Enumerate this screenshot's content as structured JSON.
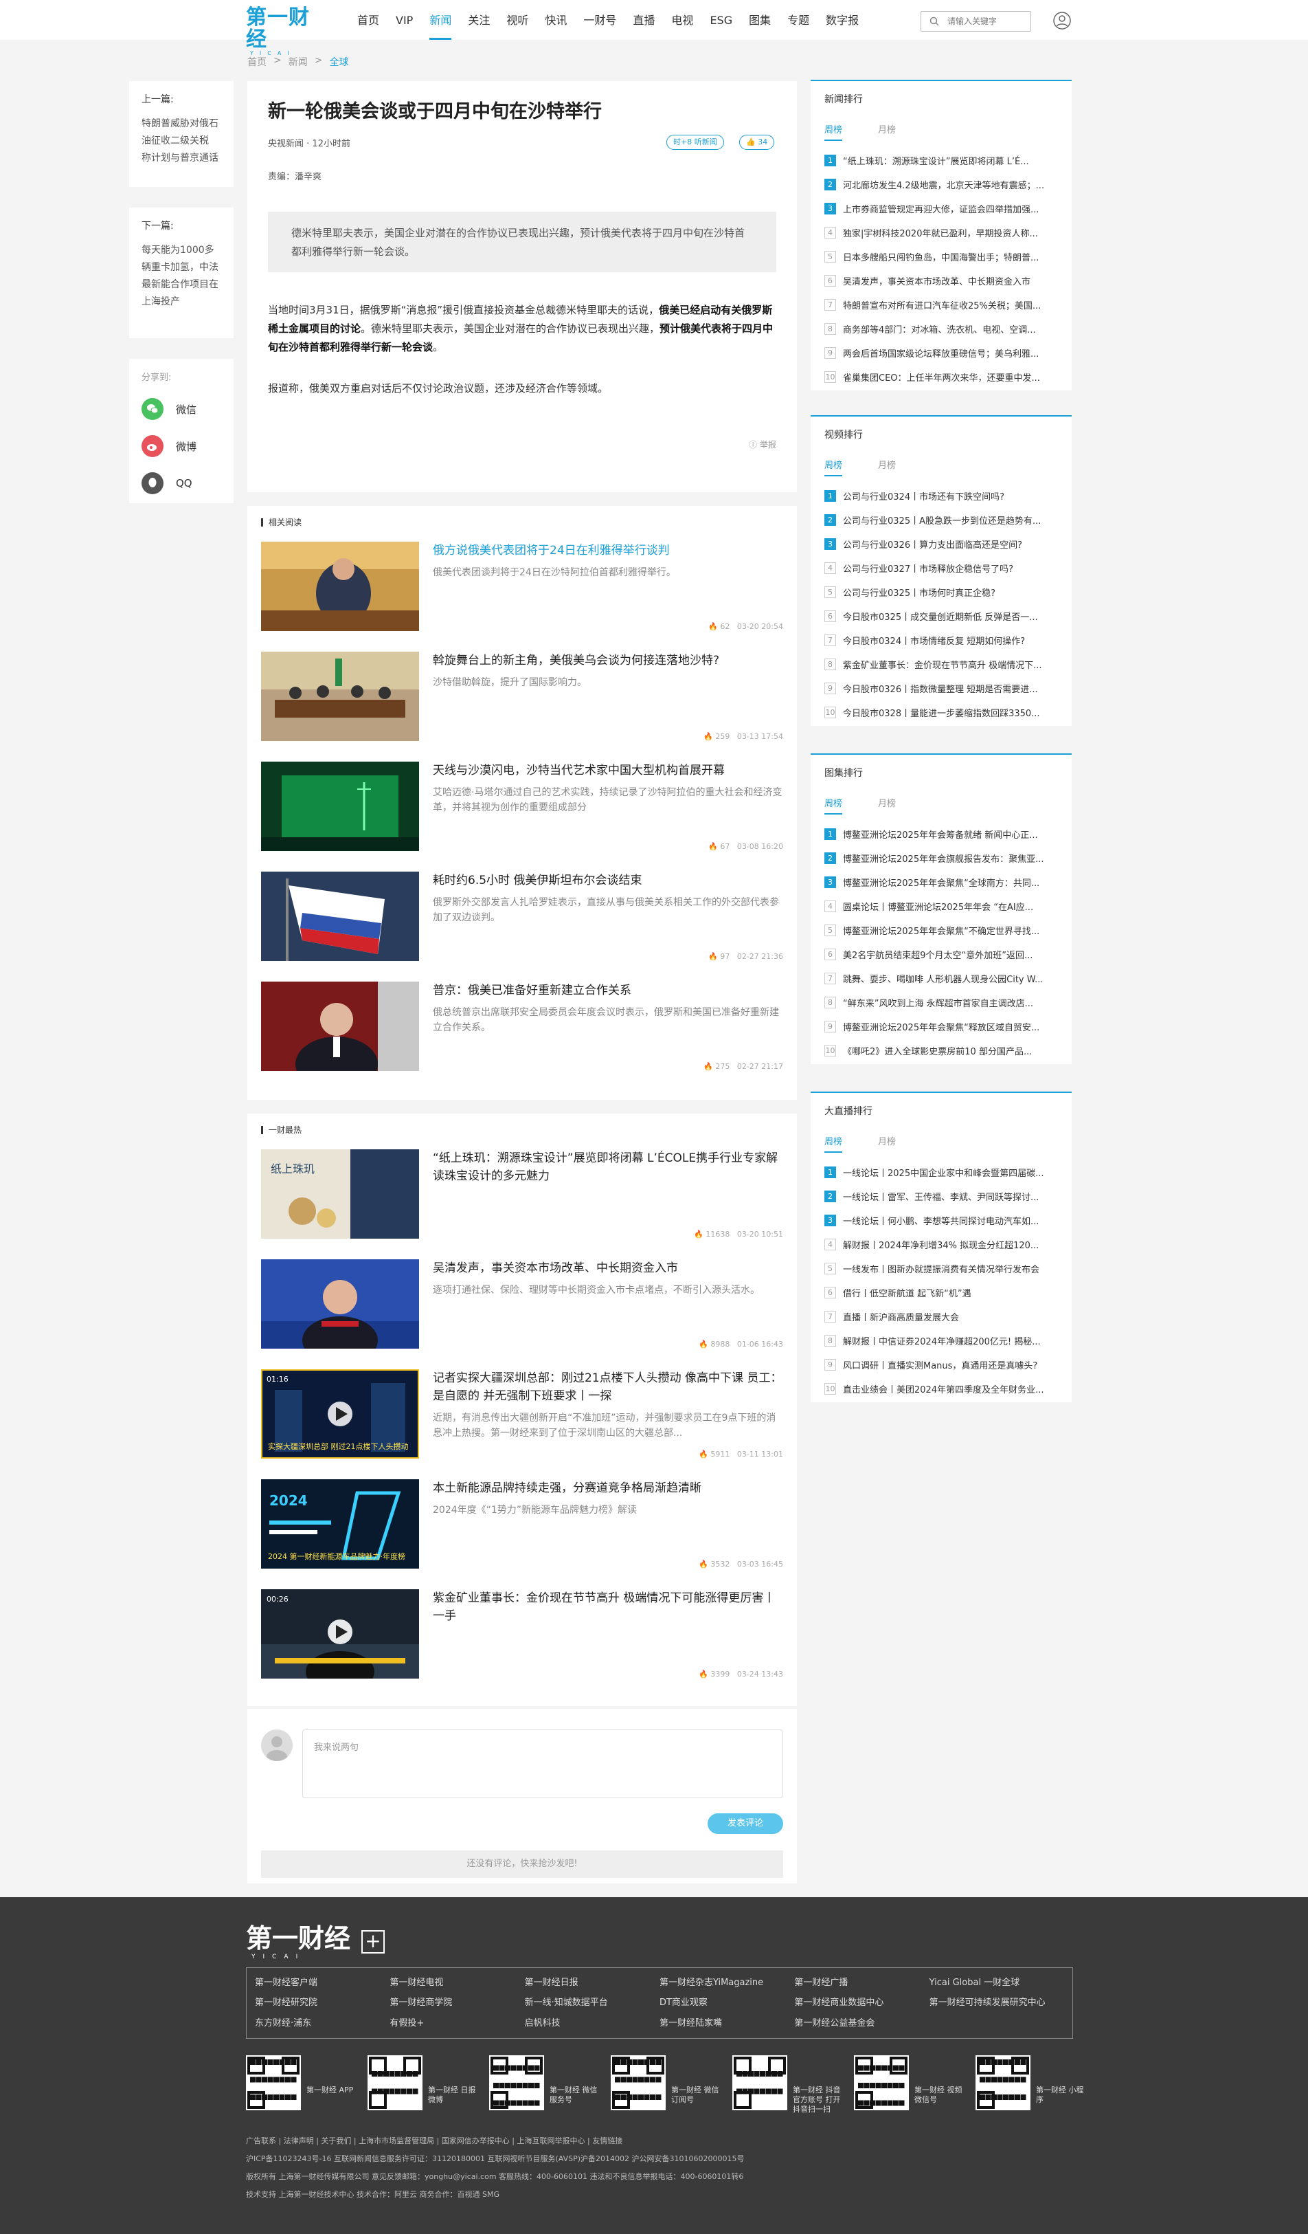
{
  "header": {
    "logo_text": "第一财经",
    "logo_sub": "YICAI",
    "nav": [
      "首页",
      "VIP",
      "新闻",
      "关注",
      "视听",
      "快讯",
      "一财号",
      "直播",
      "电视",
      "ESG",
      "图集",
      "专题",
      "数字报"
    ],
    "active_nav_index": 2,
    "search_placeholder": "请输入关键字"
  },
  "breadcrumb": [
    "首页",
    "新闻",
    "全球"
  ],
  "left_rail": {
    "prev_label": "上一篇:",
    "prev_title": "特朗普威胁对俄石油征收二级关税 称计划与普京通话",
    "next_label": "下一篇:",
    "next_title": "每天能为1000多辆重卡加氢，中法最新能合作项目在上海投产",
    "share_label": "分享到:",
    "share": [
      {
        "name": "微信",
        "color": "#48c160"
      },
      {
        "name": "微博",
        "color": "#e8525a"
      },
      {
        "name": "QQ",
        "color": "#555555"
      }
    ]
  },
  "article": {
    "title": "新一轮俄美会谈或于四月中旬在沙特举行",
    "source": "央视新闻",
    "time": "12小时前",
    "editor": "责编：潘辛爽",
    "tag": "时+8 听新闻",
    "like": "34",
    "summary": "德米特里耶夫表示，美国企业对潜在的合作协议已表现出兴趣，预计俄美代表将于四月中旬在沙特首都利雅得举行新一轮会谈。",
    "p1a": "当地时间3月31日，据俄罗斯“消息报”援引俄直接投资基金总裁德米特里耶夫的话说，",
    "p1b": "俄美已经启动有关俄罗斯稀土金属项目的讨论",
    "p1c": "。德米特里耶夫表示，美国企业对潜在的合作协议已表现出兴趣，",
    "p1d": "预计俄美代表将于四月中旬在沙特首都利雅得举行新一轮会谈",
    "p1e": "。",
    "p2": "报道称，俄美双方重启对话后不仅讨论政治议题，还涉及经济合作等领域。",
    "report": "举报"
  },
  "related": {
    "label": "相关阅读",
    "items": [
      {
        "title": "俄方说俄美代表团将于24日在利雅得举行谈判",
        "desc": "俄美代表团谈判将于24日在沙特阿拉伯首都利雅得举行。",
        "views": "62",
        "date": "03-20 20:54"
      },
      {
        "title": "斡旋舞台上的新主角，美俄美乌会谈为何接连落地沙特?",
        "desc": "沙特借助斡旋，提升了国际影响力。",
        "views": "259",
        "date": "03-13 17:54"
      },
      {
        "title": "天线与沙漠闪电，沙特当代艺术家中国大型机构首展开幕",
        "desc": "艾哈迈德·马塔尔通过自己的艺术实践，持续记录了沙特阿拉伯的重大社会和经济变革，并将其视为创作的重要组成部分",
        "views": "67",
        "date": "03-08 16:20"
      },
      {
        "title": "耗时约6.5小时 俄美伊斯坦布尔会谈结束",
        "desc": "俄罗斯外交部发言人扎哈罗娃表示，直接从事与俄美关系相关工作的外交部代表参加了双边谈判。",
        "views": "97",
        "date": "02-27 21:36"
      },
      {
        "title": "普京：俄美已准备好重新建立合作关系",
        "desc": "俄总统普京出席联邦安全局委员会年度会议时表示，俄罗斯和美国已准备好重新建立合作关系。",
        "views": "275",
        "date": "02-27 21:17"
      }
    ]
  },
  "hot": {
    "label": "一财最热",
    "items": [
      {
        "title": "“纸上珠玑：溯源珠宝设计”展览即将闭幕 L’ÉCOLE携手行业专家解读珠宝设计的多元魅力",
        "desc": "",
        "views": "11638",
        "date": "03-20 10:51"
      },
      {
        "title": "吴清发声，事关资本市场改革、中长期资金入市",
        "desc": "逐项打通社保、保险、理财等中长期资金入市卡点堵点，不断引入源头活水。",
        "views": "8988",
        "date": "01-06 16:43"
      },
      {
        "title": "记者实探大疆深圳总部：刚过21点楼下人头攒动 像高中下课 员工：是自愿的 并无强制下班要求丨一探",
        "desc": "近期，有消息传出大疆创新开启“不准加班”运动，并强制要求员工在9点下班的消息冲上热搜。第一财经来到了位于深圳南山区的大疆总部...",
        "views": "5911",
        "date": "03-11 13:01",
        "video_time": "01:16",
        "overlay": "实探大疆深圳总部 刚过21点楼下人头攒动"
      },
      {
        "title": "本土新能源品牌持续走强，分赛道竞争格局渐趋清晰",
        "desc": "2024年度《“1势力”新能源车品牌魅力榜》解读",
        "views": "3532",
        "date": "03-03 16:45",
        "overlay": "2024 第一财经新能源车品牌魅力·年度榜"
      },
      {
        "title": "紫金矿业董事长：金价现在节节高升 极端情况下可能涨得更厉害丨一手",
        "desc": "",
        "views": "3399",
        "date": "03-24 13:43",
        "video_time": "00:26"
      }
    ]
  },
  "comment": {
    "placeholder": "我来说两句",
    "submit": "发表评论",
    "empty": "还没有评论，快来抢沙发吧!"
  },
  "ranks": [
    {
      "title": "新闻排行",
      "tabs": [
        "周榜",
        "月榜"
      ],
      "items": [
        "“纸上珠玑：溯源珠宝设计”展览即将闭幕 L’É...",
        "河北廊坊发生4.2级地震，北京天津等地有震感；...",
        "上市券商监管规定再迎大修，证监会四举措加强...",
        "独家|宇树科技2020年就已盈利，早期投资人称...",
        "日本多艘船只闯钓鱼岛，中国海警出手；特朗普...",
        "吴清发声，事关资本市场改革、中长期资金入市",
        "特朗普宣布对所有进口汽车征收25%关税；美国...",
        "商务部等4部门：对冰箱、洗衣机、电视、空调...",
        "两会后首场国家级论坛释放重磅信号；美乌利雅...",
        "雀巢集团CEO：上任半年两次来华，还要重中发..."
      ]
    },
    {
      "title": "视频排行",
      "tabs": [
        "周榜",
        "月榜"
      ],
      "items": [
        "公司与行业0324丨市场还有下跌空间吗?",
        "公司与行业0325丨A股急跌一步到位还是趋势有...",
        "公司与行业0326丨算力支出面临高还是空间?",
        "公司与行业0327丨市场释放企稳信号了吗?",
        "公司与行业0325丨市场何时真正企稳?",
        "今日股市0325丨成交量创近期新低 反弹是否一...",
        "今日股市0324丨市场情绪反复 短期如何操作?",
        "紫金矿业董事长：金价现在节节高升 极端情况下...",
        "今日股市0326丨指数微量整理 短期是否需要进...",
        "今日股市0328丨量能进一步萎缩指数回踩3350..."
      ]
    },
    {
      "title": "图集排行",
      "tabs": [
        "周榜",
        "月榜"
      ],
      "items": [
        "博鳌亚洲论坛2025年年会筹备就绪 新闻中心正...",
        "博鳌亚洲论坛2025年年会旗舰报告发布：聚焦亚...",
        "博鳌亚洲论坛2025年年会聚焦“全球南方：共同...",
        "圆桌论坛丨博鳌亚洲论坛2025年年会 “在AI应...",
        "博鳌亚洲论坛2025年年会聚焦“不确定世界寻找...",
        "美2名宇航员结束超9个月太空“意外加班”返回...",
        "跳舞、耍步、喝咖啡 人形机器人现身公园City W...",
        "“鲜东来”风吹到上海 永辉超市首家自主调改店...",
        "博鳌亚洲论坛2025年年会聚焦“释放区域自贸安...",
        "《哪吒2》进入全球影史票房前10 部分国产品..."
      ]
    },
    {
      "title": "大直播排行",
      "tabs": [
        "周榜",
        "月榜"
      ],
      "items": [
        "一线论坛丨2025中国企业家中和峰会暨第四届碳...",
        "一线论坛丨雷军、王传福、李斌、尹同跃等探讨...",
        "一线论坛丨何小鹏、李想等共同探讨电动汽车如...",
        "解财报丨2024年净利增34% 拟现金分红超120...",
        "一线发布丨图新办就提振消费有关情况举行发布会",
        "借行丨低空新航道 起飞新“机”遇",
        "直播丨新沪商高质量发展大会",
        "解财报丨中信证券2024年净赚超200亿元! 揭秘...",
        "风口调研丨直播实测Manus，真通用还是真噱头?",
        "直击业绩会丨美团2024年第四季度及全年财务业..."
      ]
    }
  ],
  "footer": {
    "logo_text": "第一财经",
    "logo_sub": "YICAI",
    "links": [
      "第一财经客户端",
      "第一财经电视",
      "第一财经日报",
      "第一财经杂志YiMagazine",
      "第一财经广播",
      "Yicai Global 一财全球",
      "第一财经研究院",
      "第一财经商学院",
      "新一线·知城数据平台",
      "DT商业观察",
      "第一财经商业数据中心",
      "第一财经可持续发展研究中心",
      "东方财经·浦东",
      "有假投+",
      "启帆科技",
      "第一财经陆家嘴",
      "第一财经公益基金会"
    ],
    "qrs": [
      "第一财经 APP",
      "第一财经 日报微博",
      "第一财经 微信服务号",
      "第一财经 微信订阅号",
      "第一财经 抖音官方账号 打开抖音扫一扫",
      "第一财经 视频微信号",
      "第一财经 小程序"
    ],
    "line1": "广告联系 | 法律声明 | 关于我们 | 上海市市场监督管理局 | 国家网信办举报中心 | 上海互联网举报中心 | 友情链接",
    "line2": "沪ICP备11023243号-16    互联网新闻信息服务许可证：31120180001    互联网视听节目服务(AVSP)沪备2014002    沪公网安备31010602000015号",
    "line3": "版权所有 上海第一财经传媒有限公司    意见反馈邮箱：yonghu@yicai.com    客服热线：400-6060101 违法和不良信息举报电话：400-6060101转6",
    "line4": "技术支持 上海第一财经技术中心    技术合作：阿里云    商务合作：百视通 SMG"
  },
  "colors": {
    "accent": "#1a9fd6",
    "footer_bg": "#3a3a3a"
  }
}
